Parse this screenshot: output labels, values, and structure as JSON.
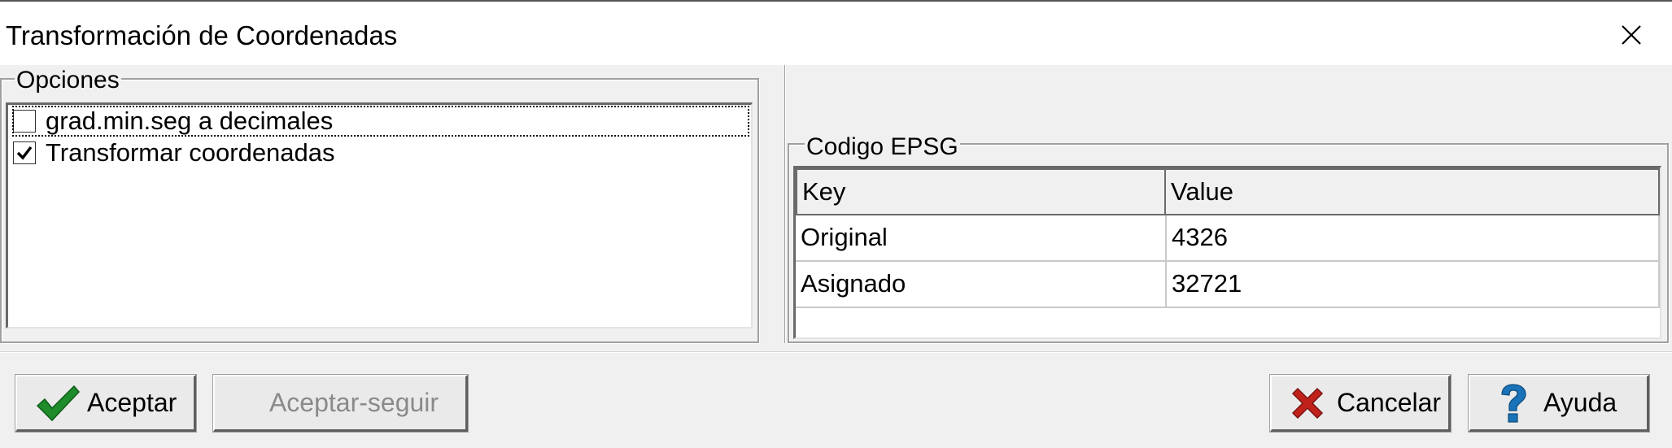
{
  "window": {
    "title": "Transformación de Coordenadas"
  },
  "titlebar": {
    "close_icon": "close-icon"
  },
  "options": {
    "legend": "Opciones",
    "items": [
      {
        "label": "grad.min.seg a decimales",
        "checked": false,
        "focused": true
      },
      {
        "label": "Transformar coordenadas",
        "checked": true,
        "focused": false
      }
    ]
  },
  "epsg": {
    "legend": "Codigo EPSG",
    "columns": [
      "Key",
      "Value"
    ],
    "rows": [
      {
        "key": "Original",
        "value": "4326"
      },
      {
        "key": "Asignado",
        "value": "32721"
      }
    ]
  },
  "buttons": {
    "accept": {
      "label": "Aceptar",
      "icon": "checkmark-icon",
      "color": "#1e8c2a"
    },
    "accept_continue": {
      "label": "Aceptar-seguir",
      "enabled": false
    },
    "cancel": {
      "label": "Cancelar",
      "icon": "red-x-icon",
      "color": "#c0221b"
    },
    "help": {
      "label": "Ayuda",
      "icon": "question-icon",
      "color": "#1a73b8"
    }
  }
}
